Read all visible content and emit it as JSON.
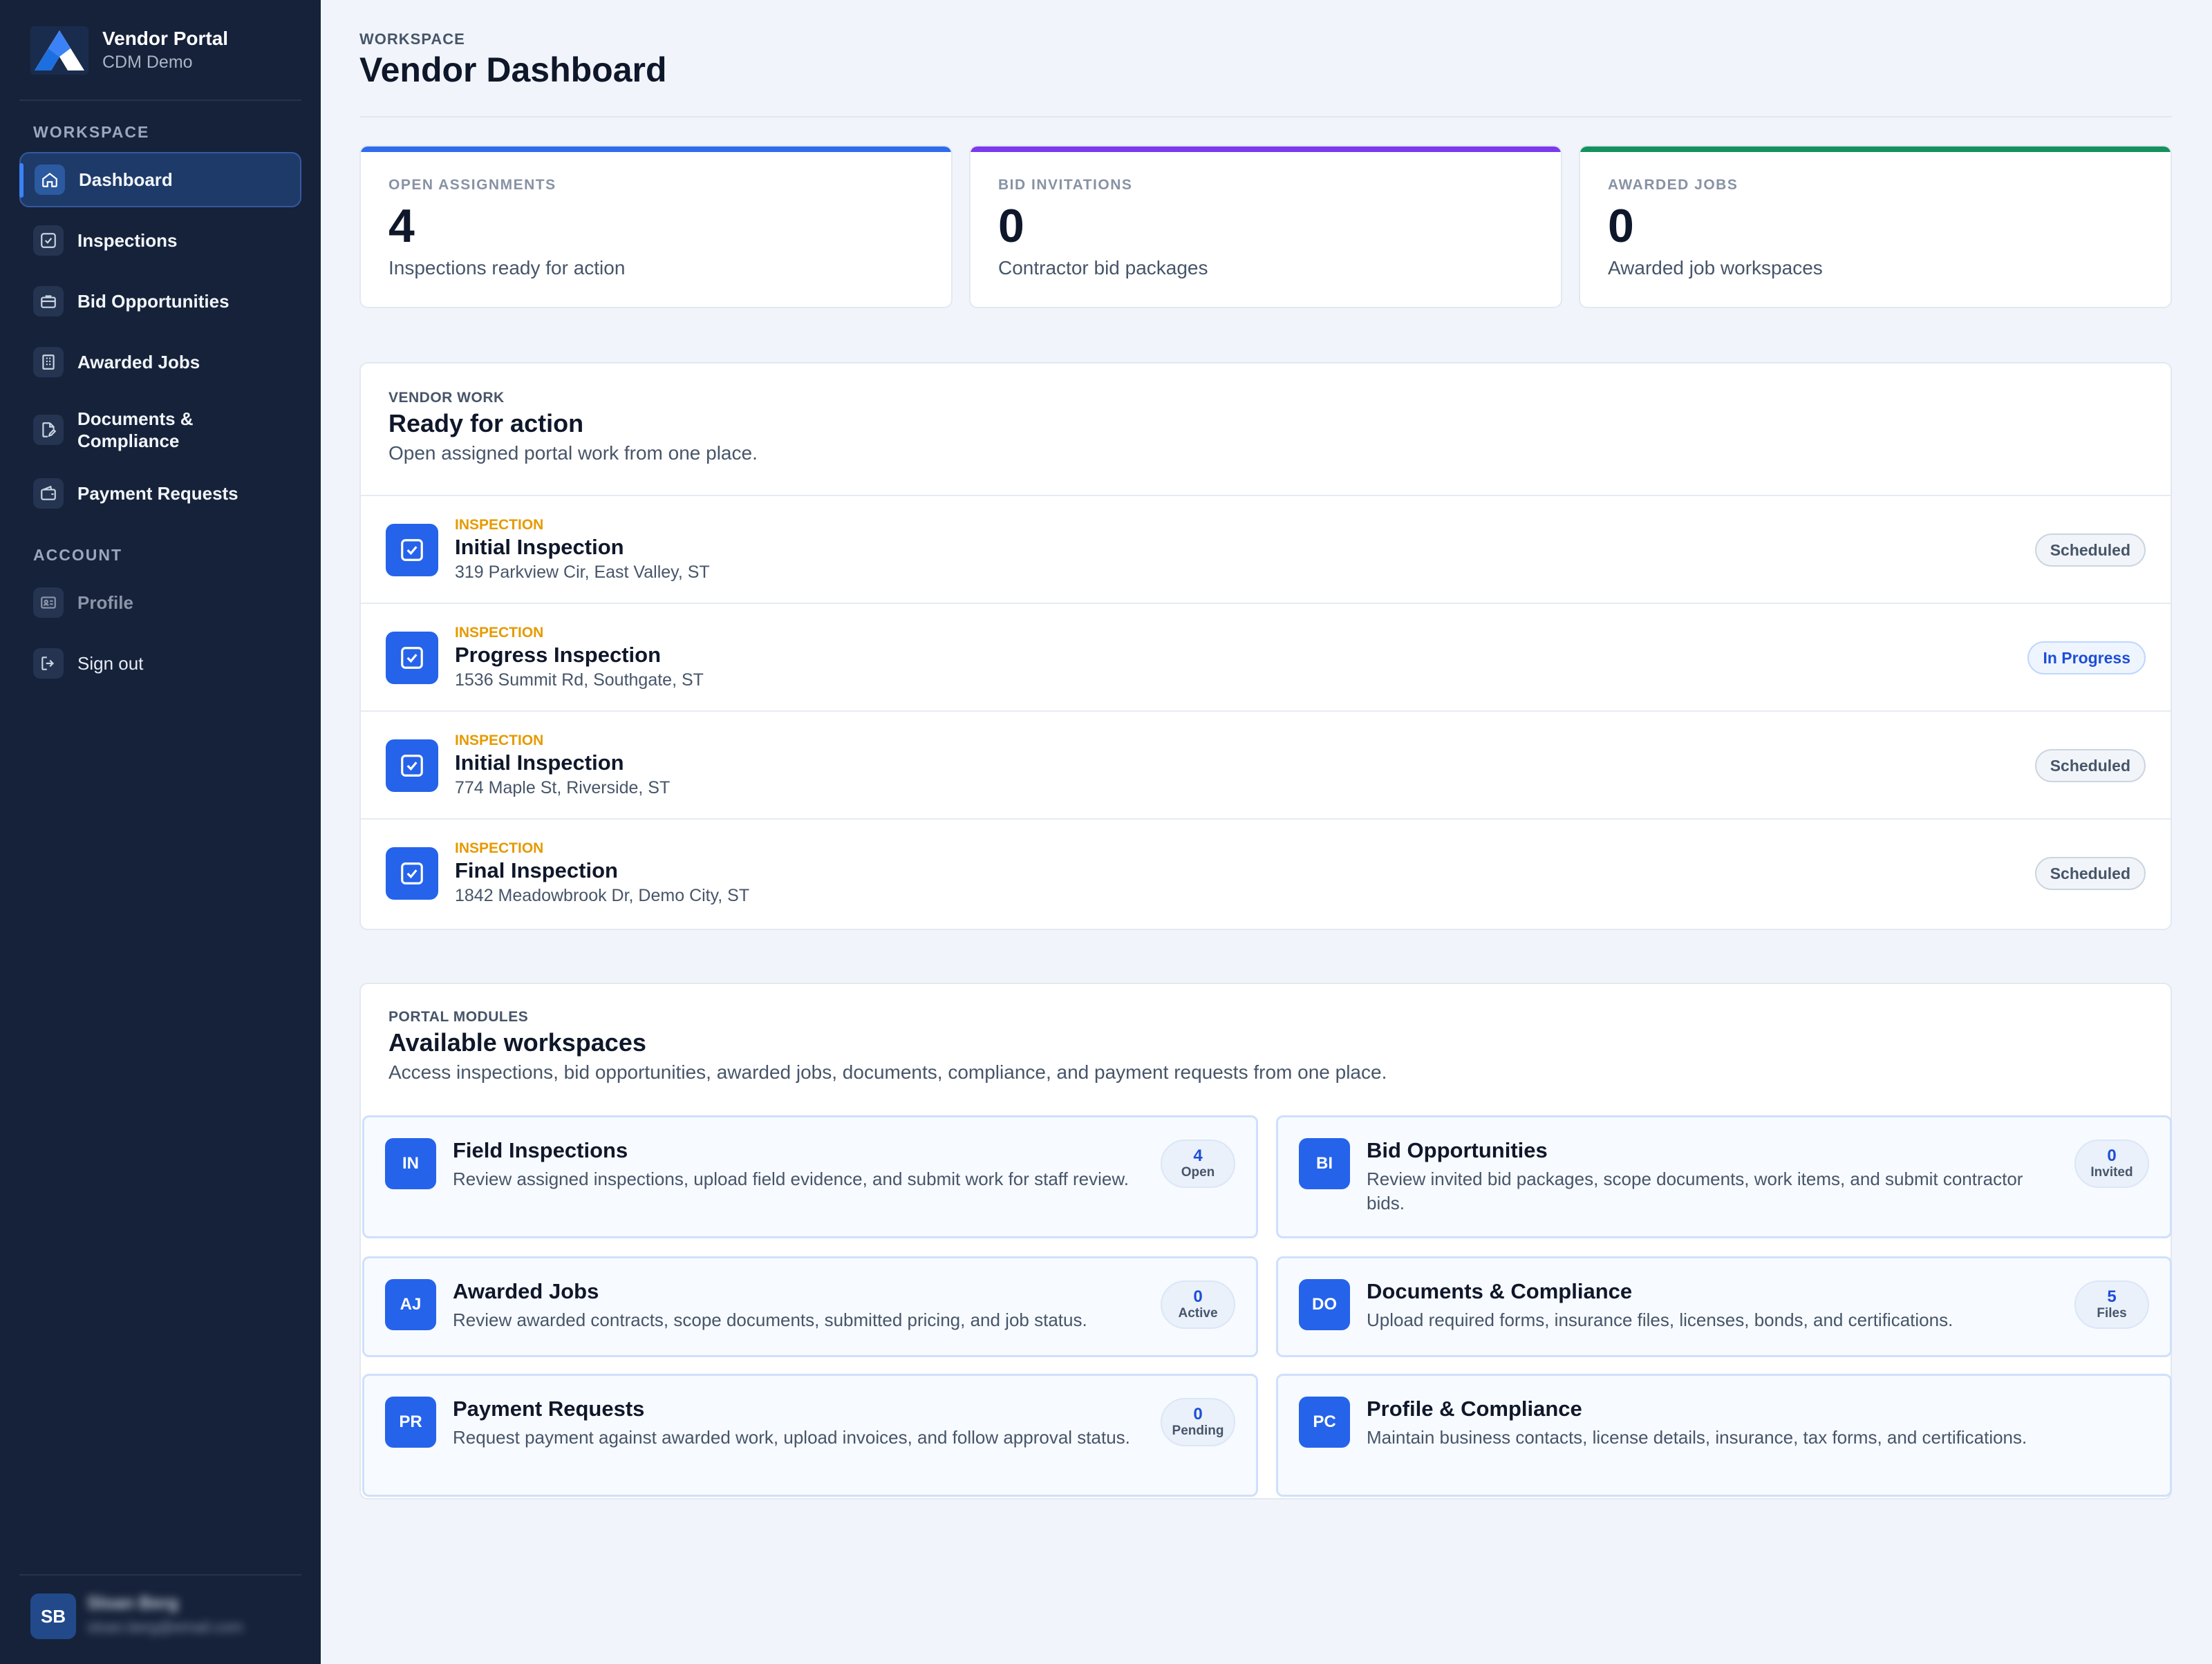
{
  "brand": {
    "title": "Vendor Portal",
    "subtitle": "CDM Demo"
  },
  "sidebar": {
    "workspace_heading": "WORKSPACE",
    "account_heading": "ACCOUNT",
    "items": [
      {
        "label": "Dashboard",
        "icon": "home-icon"
      },
      {
        "label": "Inspections",
        "icon": "checkbox-icon"
      },
      {
        "label": "Bid Opportunities",
        "icon": "briefcase-icon"
      },
      {
        "label": "Awarded Jobs",
        "icon": "building-icon"
      },
      {
        "label": "Documents & Compliance",
        "icon": "document-edit-icon"
      },
      {
        "label": "Payment Requests",
        "icon": "wallet-icon"
      }
    ],
    "account_items": [
      {
        "label": "Profile",
        "icon": "id-card-icon"
      },
      {
        "label": "Sign out",
        "icon": "sign-out-icon"
      }
    ],
    "user": {
      "initials": "SB",
      "name": "Sloan Berg",
      "email": "sloan.berg@email.com"
    }
  },
  "header": {
    "eyebrow": "WORKSPACE",
    "title": "Vendor Dashboard"
  },
  "stats": [
    {
      "label": "OPEN ASSIGNMENTS",
      "value": "4",
      "desc": "Inspections ready for action",
      "color": "#2f6bea"
    },
    {
      "label": "BID INVITATIONS",
      "value": "0",
      "desc": "Contractor bid packages",
      "color": "#7c3aed"
    },
    {
      "label": "AWARDED JOBS",
      "value": "0",
      "desc": "Awarded job workspaces",
      "color": "#14915f"
    }
  ],
  "vendor_work": {
    "eyebrow": "VENDOR WORK",
    "title": "Ready for action",
    "subtitle": "Open assigned portal work from one place.",
    "rows": [
      {
        "type": "INSPECTION",
        "title": "Initial Inspection",
        "address": "319 Parkview Cir, East Valley, ST",
        "status": "Scheduled"
      },
      {
        "type": "INSPECTION",
        "title": "Progress Inspection",
        "address": "1536 Summit Rd, Southgate, ST",
        "status": "In Progress"
      },
      {
        "type": "INSPECTION",
        "title": "Initial Inspection",
        "address": "774 Maple St, Riverside, ST",
        "status": "Scheduled"
      },
      {
        "type": "INSPECTION",
        "title": "Final Inspection",
        "address": "1842 Meadowbrook Dr, Demo City, ST",
        "status": "Scheduled"
      }
    ]
  },
  "modules": {
    "eyebrow": "PORTAL MODULES",
    "title": "Available workspaces",
    "subtitle": "Access inspections, bid opportunities, awarded jobs, documents, compliance, and payment requests from one place.",
    "items": [
      {
        "abbr": "IN",
        "title": "Field Inspections",
        "desc": "Review assigned inspections, upload field evidence, and submit work for staff review.",
        "count": "4",
        "count_label": "Open"
      },
      {
        "abbr": "BI",
        "title": "Bid Opportunities",
        "desc": "Review invited bid packages, scope documents, work items, and submit contractor bids.",
        "count": "0",
        "count_label": "Invited"
      },
      {
        "abbr": "AJ",
        "title": "Awarded Jobs",
        "desc": "Review awarded contracts, scope documents, submitted pricing, and job status.",
        "count": "0",
        "count_label": "Active"
      },
      {
        "abbr": "DO",
        "title": "Documents & Compliance",
        "desc": "Upload required forms, insurance files, licenses, bonds, and certifications.",
        "count": "5",
        "count_label": "Files"
      },
      {
        "abbr": "PR",
        "title": "Payment Requests",
        "desc": "Request payment against awarded work, upload invoices, and follow approval status.",
        "count": "0",
        "count_label": "Pending"
      },
      {
        "abbr": "PC",
        "title": "Profile & Compliance",
        "desc": "Maintain business contacts, license details, insurance, tax forms, and certifications."
      }
    ]
  }
}
